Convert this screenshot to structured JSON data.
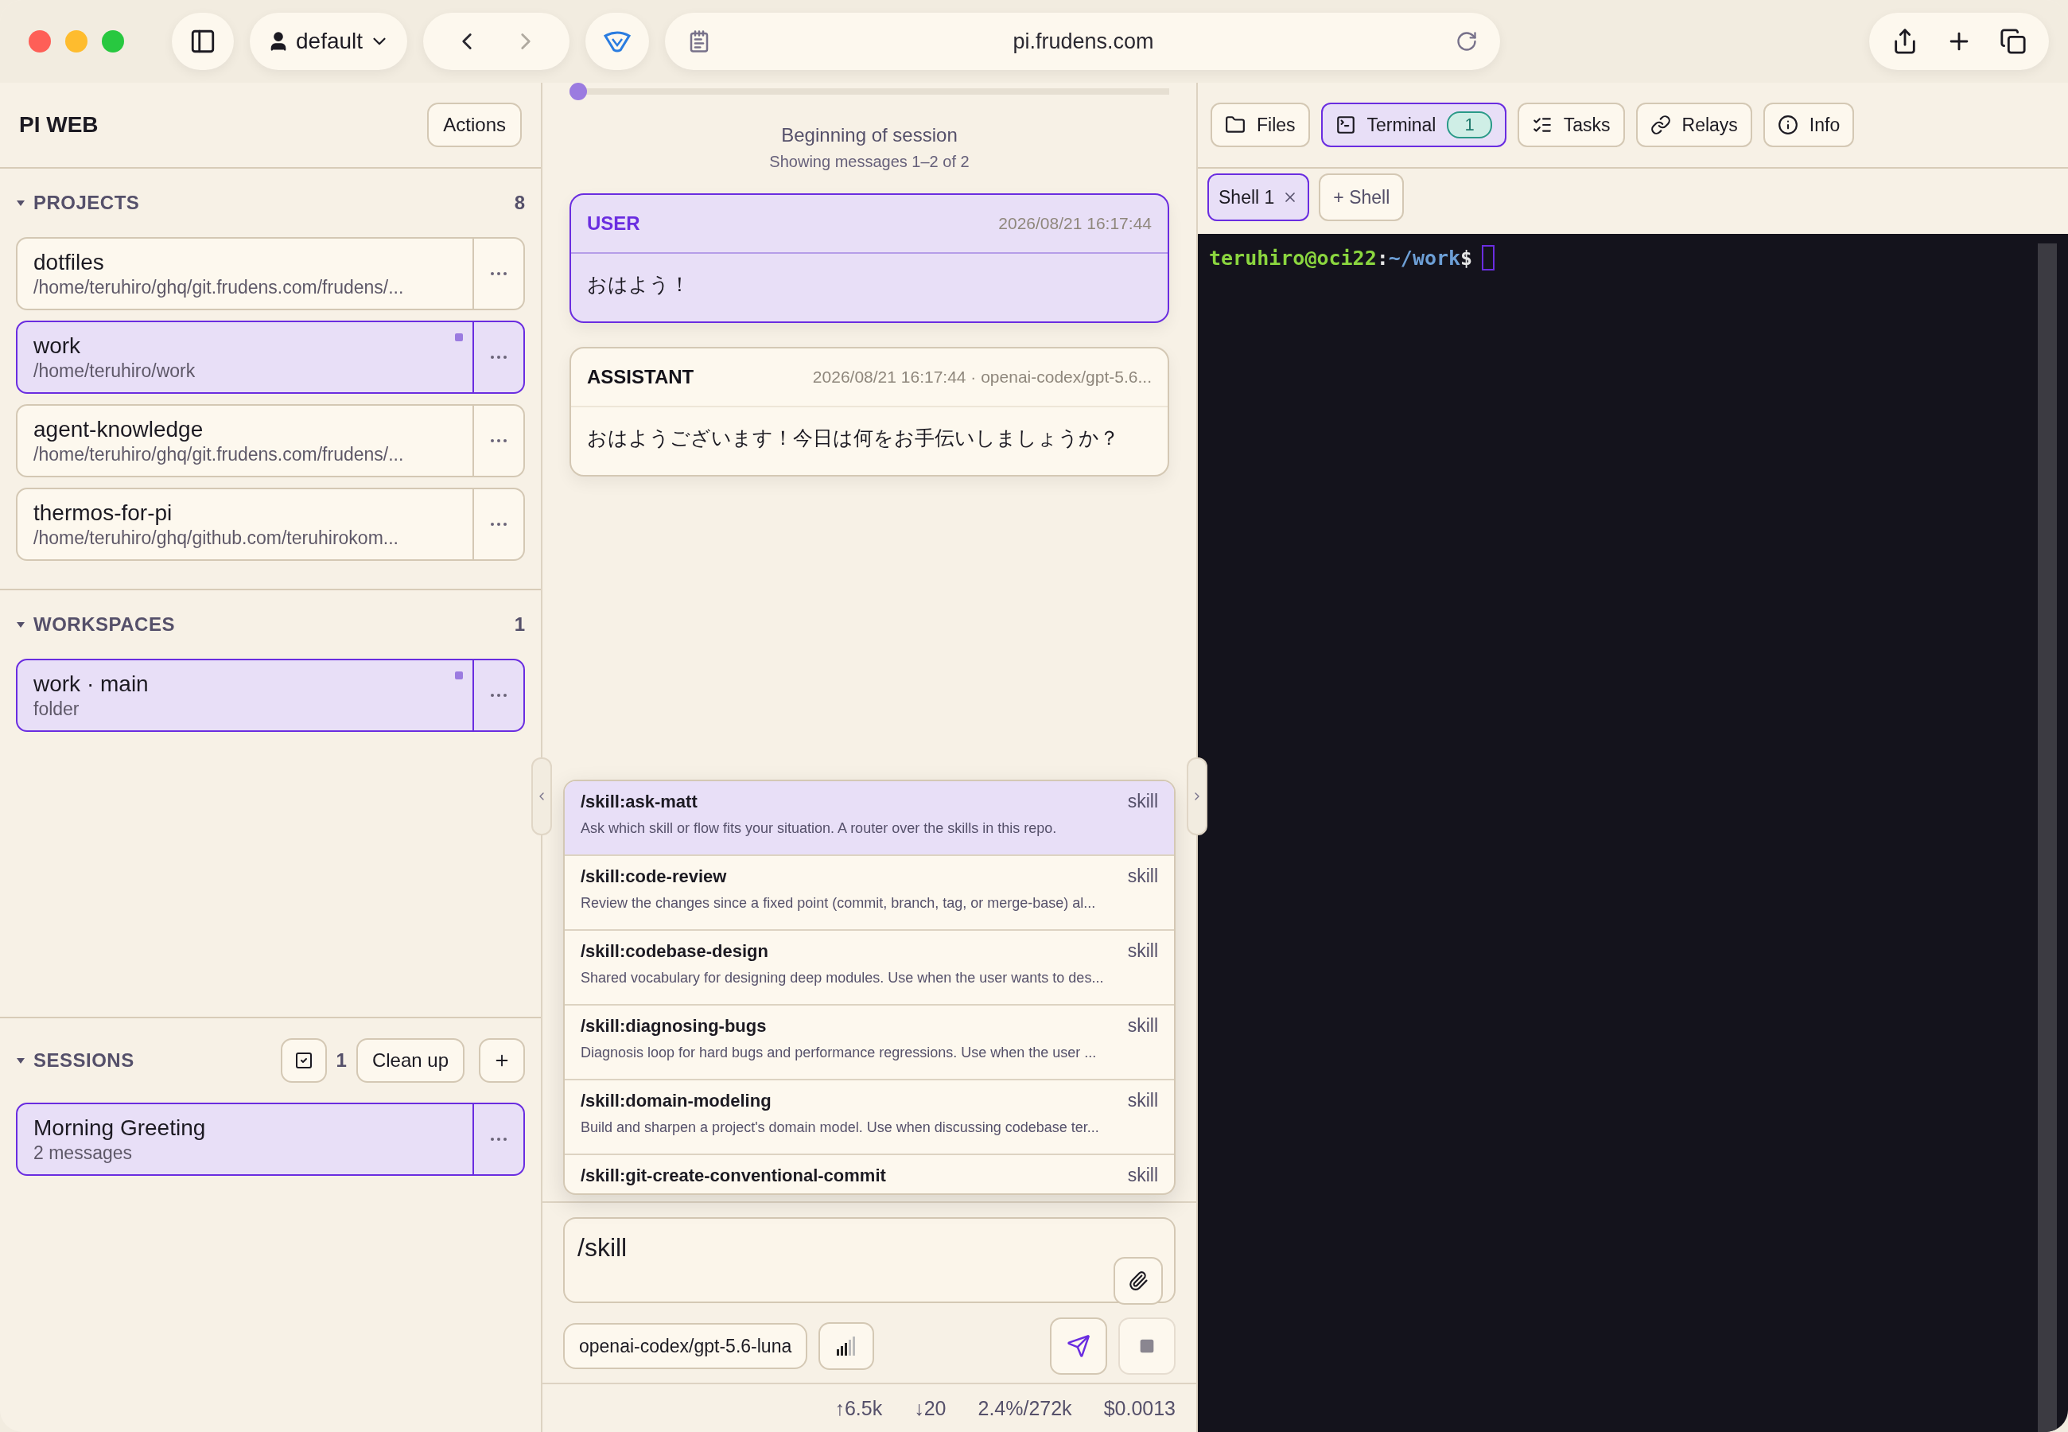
{
  "browser": {
    "profile": "default",
    "url": "pi.frudens.com",
    "forward_disabled": true
  },
  "sidebar": {
    "title": "PI WEB",
    "actions": "Actions",
    "projects": {
      "label": "PROJECTS",
      "count": "8",
      "expanded": true,
      "items": [
        {
          "name": "dotfiles",
          "path": "/home/teruhiro/ghq/git.frudens.com/frudens/...",
          "selected": false,
          "unread": false
        },
        {
          "name": "work",
          "path": "/home/teruhiro/work",
          "selected": true,
          "unread": true
        },
        {
          "name": "agent-knowledge",
          "path": "/home/teruhiro/ghq/git.frudens.com/frudens/...",
          "selected": false,
          "unread": false
        },
        {
          "name": "thermos-for-pi",
          "path": "/home/teruhiro/ghq/github.com/teruhirokom...",
          "selected": false,
          "unread": false
        }
      ]
    },
    "workspaces": {
      "label": "WORKSPACES",
      "count": "1",
      "expanded": true,
      "items": [
        {
          "name": "work · main",
          "path": "folder",
          "selected": true,
          "unread": true
        }
      ]
    },
    "sessions": {
      "label": "SESSIONS",
      "count": "1",
      "expanded": true,
      "cleanup": "Clean up",
      "items": [
        {
          "name": "Morning Greeting",
          "path": "2 messages",
          "selected": true,
          "unread": false
        }
      ]
    }
  },
  "chat": {
    "timeline": {
      "level": 0
    },
    "title": "Beginning of session",
    "subtitle": "Showing messages 1–2 of 2",
    "messages": [
      {
        "kind": "user",
        "role": "USER",
        "meta": "2026/08/21 16:17:44",
        "text": "おはよう！"
      },
      {
        "kind": "assistant",
        "role": "ASSISTANT",
        "meta": "2026/08/21 16:17:44 · openai-codex/gpt-5.6...",
        "text": "おはようございます！今日は何をお手伝いしましょうか？"
      }
    ],
    "suggestions": [
      {
        "command": "/skill:ask-matt",
        "type": "skill",
        "description": "Ask which skill or flow fits your situation. A router over the skills in this repo.",
        "selected": true
      },
      {
        "command": "/skill:code-review",
        "type": "skill",
        "description": "Review the changes since a fixed point (commit, branch, tag, or merge-base) al...",
        "selected": false
      },
      {
        "command": "/skill:codebase-design",
        "type": "skill",
        "description": "Shared vocabulary for designing deep modules. Use when the user wants to des...",
        "selected": false
      },
      {
        "command": "/skill:diagnosing-bugs",
        "type": "skill",
        "description": "Diagnosis loop for hard bugs and performance regressions. Use when the user ...",
        "selected": false
      },
      {
        "command": "/skill:domain-modeling",
        "type": "skill",
        "description": "Build and sharpen a project's domain model. Use when discussing codebase ter...",
        "selected": false
      },
      {
        "command": "/skill:git-create-conventional-commit",
        "type": "skill",
        "selected": false
      }
    ],
    "composer": {
      "value": "/skill",
      "model": "openai-codex/gpt-5.6-luna",
      "stop_disabled": true
    },
    "stats": [
      "↑6.5k",
      "↓20",
      "2.4%/272k",
      "$0.0013"
    ]
  },
  "panel": {
    "tabs": [
      {
        "kind": "files",
        "label": "Files",
        "selected": false
      },
      {
        "kind": "terminal",
        "label": "Terminal",
        "badge": "1",
        "selected": true
      },
      {
        "kind": "tasks",
        "label": "Tasks",
        "selected": false
      },
      {
        "kind": "relays",
        "label": "Relays",
        "selected": false
      },
      {
        "kind": "info",
        "label": "Info",
        "selected": false
      }
    ],
    "shells": [
      {
        "label": "Shell 1",
        "selected": true
      }
    ],
    "add_shell": "+ Shell",
    "terminal": [
      {
        "text": "teruhiro@oci22",
        "color": "#8bd63f"
      },
      {
        "text": ":",
        "color": "#e6e6e6"
      },
      {
        "text": "~/work",
        "color": "#6d9fd6"
      },
      {
        "text": "$",
        "color": "#e6e6e6"
      }
    ]
  }
}
